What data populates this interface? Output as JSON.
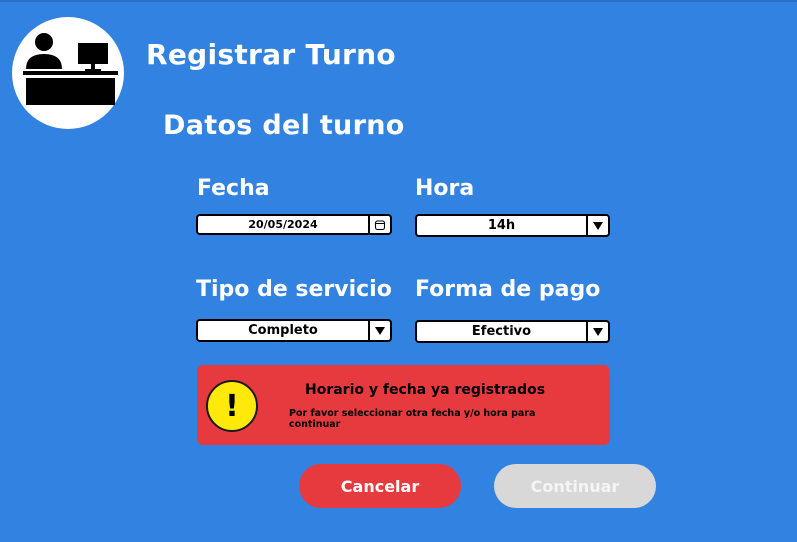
{
  "header": {
    "title": "Registrar Turno",
    "logo_icon": "receptionist-desk-icon"
  },
  "form": {
    "section_title": "Datos del turno",
    "fecha": {
      "label": "Fecha",
      "value": "20/05/2024",
      "icon": "calendar-icon"
    },
    "hora": {
      "label": "Hora",
      "value": "14h",
      "icon": "dropdown-arrow-icon"
    },
    "tipo_servicio": {
      "label": "Tipo de servicio",
      "value": "Completo",
      "icon": "dropdown-arrow-icon"
    },
    "forma_pago": {
      "label": "Forma de pago",
      "value": "Efectivo",
      "icon": "dropdown-arrow-icon"
    }
  },
  "alert": {
    "icon": "warning-icon",
    "symbol": "!",
    "title": "Horario y fecha ya registrados",
    "message": "Por favor seleccionar otra fecha y/o hora para continuar",
    "color": "#e63a3e"
  },
  "buttons": {
    "cancel": "Cancelar",
    "continue": "Continuar"
  },
  "colors": {
    "background": "#3282e2",
    "danger": "#e63a3e",
    "disabled": "#d8d8d8",
    "warning": "#ffe90a"
  }
}
